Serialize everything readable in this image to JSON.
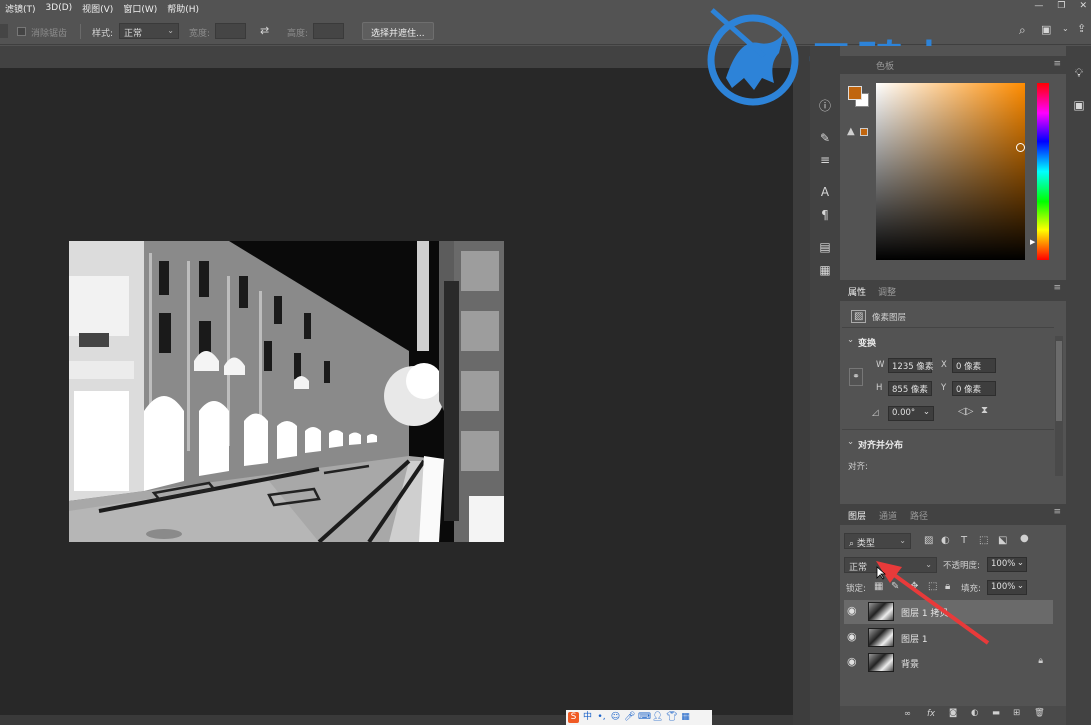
{
  "menu": {
    "items": [
      "滤镜(T)",
      "3D(D)",
      "视图(V)",
      "窗口(W)",
      "帮助(H)"
    ],
    "window_controls": [
      "—",
      "❐",
      "✕"
    ]
  },
  "options": {
    "remove_jaggies": "消除锯齿",
    "style_label": "样式:",
    "style_value": "正常",
    "width_label": "宽度:",
    "height_label": "高度:",
    "select_mask_button": "选择并遮住..."
  },
  "watermark": {
    "text": "云骑士",
    "color": "#2d83d8"
  },
  "color_panel": {
    "tab_label": "色板",
    "foreground": "#c0650e",
    "background": "#ffffff",
    "hue_color": "#ff8c00"
  },
  "properties": {
    "tabs": [
      "属性",
      "调整"
    ],
    "layer_type": "像素图层",
    "transform_title": "变换",
    "w_label": "W",
    "w_value": "1235 像素",
    "x_label": "X",
    "x_value": "0 像素",
    "h_label": "H",
    "h_value": "855 像素",
    "y_label": "Y",
    "y_value": "0 像素",
    "angle_value": "0.00°",
    "align_title": "对齐并分布",
    "align_label": "对齐:"
  },
  "layers": {
    "tabs": [
      "图层",
      "通道",
      "路径"
    ],
    "filter_kind": "类型",
    "blend_mode": "正常",
    "opacity_label": "不透明度:",
    "opacity_value": "100%",
    "lock_label": "锁定:",
    "fill_label": "填充:",
    "fill_value": "100%",
    "items": [
      {
        "name": "图层 1 拷贝"
      },
      {
        "name": "图层 1"
      },
      {
        "name": "背景"
      }
    ],
    "footer_icons": [
      "link-icon",
      "fx-icon",
      "mask-icon",
      "adjustment-icon",
      "group-icon",
      "new-layer-icon",
      "trash-icon"
    ],
    "footer_fx": "fx"
  },
  "taskbar": {
    "ime_label": "中"
  }
}
